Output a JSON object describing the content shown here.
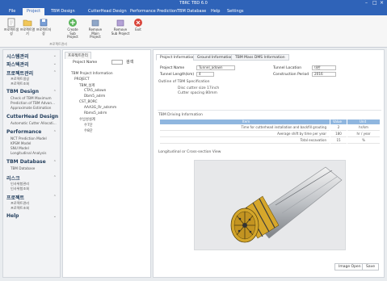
{
  "window": {
    "title": "TBRC TBD 6.0"
  },
  "menu": [
    {
      "label": "File"
    },
    {
      "label": "Project"
    },
    {
      "label": "TBM Design"
    },
    {
      "label": "CutterHead Design"
    },
    {
      "label": "Performance Prediction"
    },
    {
      "label": "TBM Database"
    },
    {
      "label": "Help"
    },
    {
      "label": "Settings"
    }
  ],
  "ribbon": {
    "buttons": [
      {
        "label": "프로젝트생성"
      },
      {
        "label": "프로젝트열기"
      },
      {
        "label": "프로젝트저장"
      },
      {
        "label": "Create Sub Project"
      },
      {
        "label": "Remove Main Project"
      },
      {
        "label": "Remove Sub Project"
      },
      {
        "label": "Exit"
      }
    ],
    "group_label": "프로젝트관리"
  },
  "sidebar": {
    "sections": [
      {
        "title": "시스템관리",
        "items": []
      },
      {
        "title": "파스텍관리",
        "items": []
      },
      {
        "title": "프로젝트관리",
        "items": [
          "프로젝트생성",
          "프로젝트조회"
        ]
      },
      {
        "title": "TBM Design",
        "items": [
          "Check of TBM Maximum",
          "Prediction of TBM Advan...",
          "Approximate Estimation"
        ]
      },
      {
        "title": "CutterHead Design",
        "items": [
          "Automatic Cutter Allocati..."
        ]
      },
      {
        "title": "Performance",
        "items": [
          "NCT Prediction Model",
          "KPSM Model",
          "SNU Model",
          "Longitudinal Analysis"
        ]
      },
      {
        "title": "TBM Database",
        "items": [
          "TBM Database"
        ]
      },
      {
        "title": "리스크",
        "items": [
          "인사위험관리",
          "인사위험조회"
        ]
      },
      {
        "title": "프로젝트",
        "items": [
          "프로젝트관리",
          "프로젝트조회"
        ]
      },
      {
        "title": "Help",
        "items": []
      }
    ]
  },
  "tree_panel": {
    "tab": "프로젝트관리",
    "label": "Project Name",
    "search_button": "검색",
    "nodes": [
      "TBM Project Information",
      "PROJECT",
      "TBM_설계",
      "CTA5_adown",
      "Dbm5_adrm",
      "CST_BORC",
      "AAA3G_Rr_adsmm",
      "Rbms5_adrm",
      "수납성설계",
      "수7단",
      "수8단"
    ]
  },
  "main": {
    "tabs": [
      {
        "label": "Project Information"
      },
      {
        "label": "Ground Information"
      },
      {
        "label": "TBM Mass DMS Information"
      }
    ],
    "fields": {
      "project_name_label": "Project Name",
      "project_name_value": "Tunnel_adown",
      "tunnel_location_label": "Tunnel Location",
      "tunnel_location_value": "대한",
      "tunnel_length_label": "Tunnel Length(km)",
      "tunnel_length_value": "4",
      "construction_period_label": "Construction Period",
      "construction_period_value": "2016"
    },
    "spec_title": "Outline of TBM Specification",
    "spec_lines": [
      "Disc cutter size   17inch",
      "Cutter spacing   80mm"
    ],
    "driving_title": "TBM Driving Information",
    "table_headers": [
      "Item",
      "Value",
      "Unit"
    ],
    "table_rows": [
      [
        "Time for cutterhead installation and backfill grouting",
        "2",
        "hr/km"
      ],
      [
        "Average shift by time per year",
        "180",
        "hr / year"
      ],
      [
        "Total excavation",
        "15",
        "%"
      ]
    ],
    "view_title": "Longitudinal or Cross-section View",
    "image_open_button": "Image Open",
    "save_button": "Save"
  }
}
